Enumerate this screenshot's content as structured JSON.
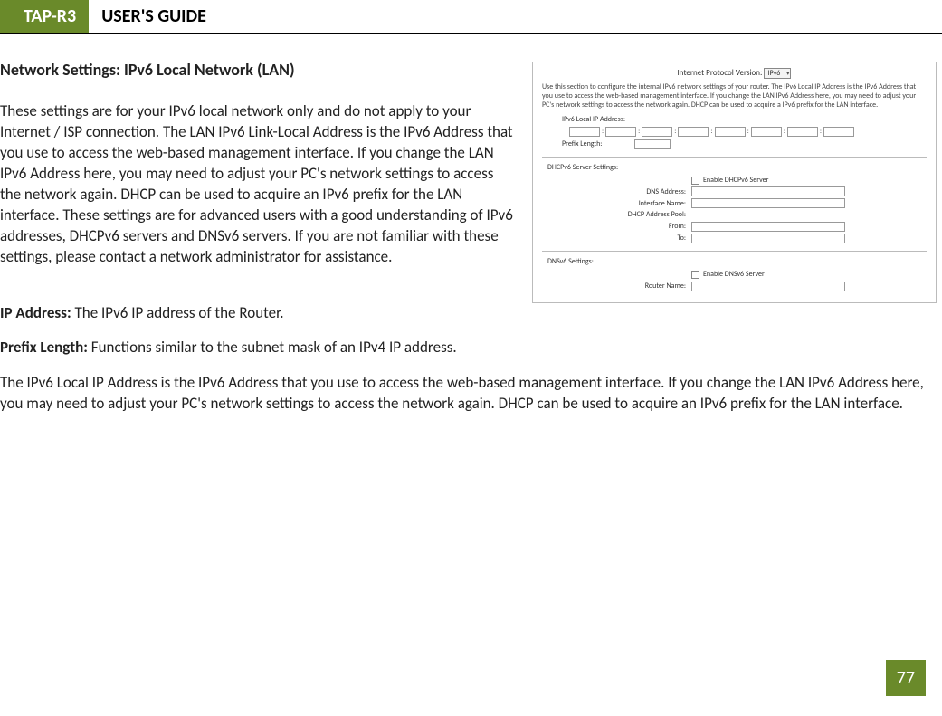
{
  "header": {
    "model": "TAP-R3",
    "title": "USER'S GUIDE"
  },
  "section_heading": "Network Settings: IPv6 Local Network (LAN)",
  "intro_para": "These settings are for your IPv6 local network only and do not apply to your Internet / ISP connection.  The LAN IPv6 Link-Local Address is the IPv6 Address that you use to access the web-based management interface. If you change the LAN IPv6 Address here, you may need to adjust your PC's network settings to access the network again. DHCP can be used to acquire an IPv6 prefix for the LAN interface.  These settings are for advanced users with a good understanding of IPv6 addresses, DHCPv6 servers and DNSv6 servers. If you are not familiar with these settings, please contact a network administrator for assistance.",
  "defs": {
    "ip_label": "IP Address:",
    "ip_text": " The IPv6 IP address of the Router.",
    "prefix_label": "Prefix Length:",
    "prefix_text": " Functions similar to the subnet mask of an IPv4 IP address."
  },
  "closing_para": "The IPv6 Local IP Address is the IPv6 Address that you use to access the web-based management interface. If you change the LAN IPv6 Address here, you may need to adjust your PC's network settings to access the network again. DHCP can be used to acquire an IPv6 prefix for the LAN interface.",
  "screenshot": {
    "top_label": "Internet Protocol Version:",
    "top_select_value": "IPv6",
    "help_text": "Use this section to configure the internal IPv6 network settings of your router. The IPv6 Local IP Address is the IPv6 Address that you use to access the web-based management interface. If you change the LAN IPv6 Address here, you may need to adjust your PC's network settings to access the network again. DHCP can be used to acquire a IPv6 prefix for the LAN interface.",
    "local_ip_label": "IPv6 Local IP Address:",
    "prefix_length_label": "Prefix Length:",
    "dhcp_section": "DHCPv6 Server Settings:",
    "enable_dhcp": "Enable DHCPv6 Server",
    "dns_address": "DNS Address:",
    "interface_name": "Interface Name:",
    "dhcp_pool": "DHCP Address Pool:",
    "from": "From:",
    "to": "To:",
    "dnsv6_section": "DNSv6 Settings:",
    "enable_dnsv6": "Enable DNSv6 Server",
    "router_name": "Router Name:"
  },
  "page_number": "77"
}
